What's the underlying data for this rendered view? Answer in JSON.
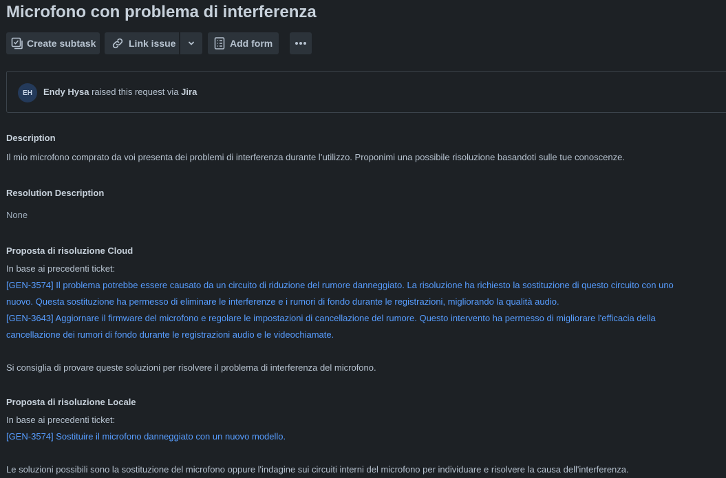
{
  "issue": {
    "title": "Microfono con problema di interferenza"
  },
  "toolbar": {
    "create_subtask": "Create subtask",
    "link_issue": "Link issue",
    "add_form": "Add form"
  },
  "reporter": {
    "initials": "EH",
    "name": "Endy Hysa",
    "middle_text": " raised this request via ",
    "channel": "Jira"
  },
  "description": {
    "label": "Description",
    "text": "Il mio microfono comprato da voi presenta dei problemi di interferenza durante l’utilizzo. Proponimi una possibile risoluzione basandoti sulle tue conoscenze."
  },
  "resolution_description": {
    "label": "Resolution Description",
    "value": "None"
  },
  "cloud_resolution": {
    "label": "Proposta di risoluzione Cloud",
    "intro": "In base ai precedenti ticket:",
    "items": [
      "[GEN-3574] Il problema potrebbe essere causato da un circuito di riduzione del rumore danneggiato. La risoluzione ha richiesto la sostituzione di questo circuito con uno nuovo. Questa sostituzione ha permesso di eliminare le interferenze e i rumori di fondo durante le registrazioni, migliorando la qualità audio.",
      "[GEN-3643] Aggiornare il firmware del microfono e regolare le impostazioni di cancellazione del rumore. Questo intervento ha permesso di migliorare l'efficacia della cancellazione dei rumori di fondo durante le registrazioni audio e le videochiamate."
    ],
    "conclusion": "Si consiglia di provare queste soluzioni per risolvere il problema di interferenza del microfono."
  },
  "local_resolution": {
    "label": "Proposta di risoluzione Locale",
    "intro": "In base ai precedenti ticket:",
    "items": [
      "[GEN-3574] Sostituire il microfono danneggiato con un nuovo modello."
    ],
    "conclusion": "Le soluzioni possibili sono la sostituzione del microfono oppure l'indagine sui circuiti interni del microfono per individuare e risolvere la causa dell'interferenza."
  },
  "colors": {
    "background": "#1d2125",
    "link": "#579dff",
    "button": "#2c333a"
  },
  "icons": [
    "subtask-icon",
    "link-icon",
    "chevron-down-icon",
    "form-icon",
    "more-icon"
  ]
}
